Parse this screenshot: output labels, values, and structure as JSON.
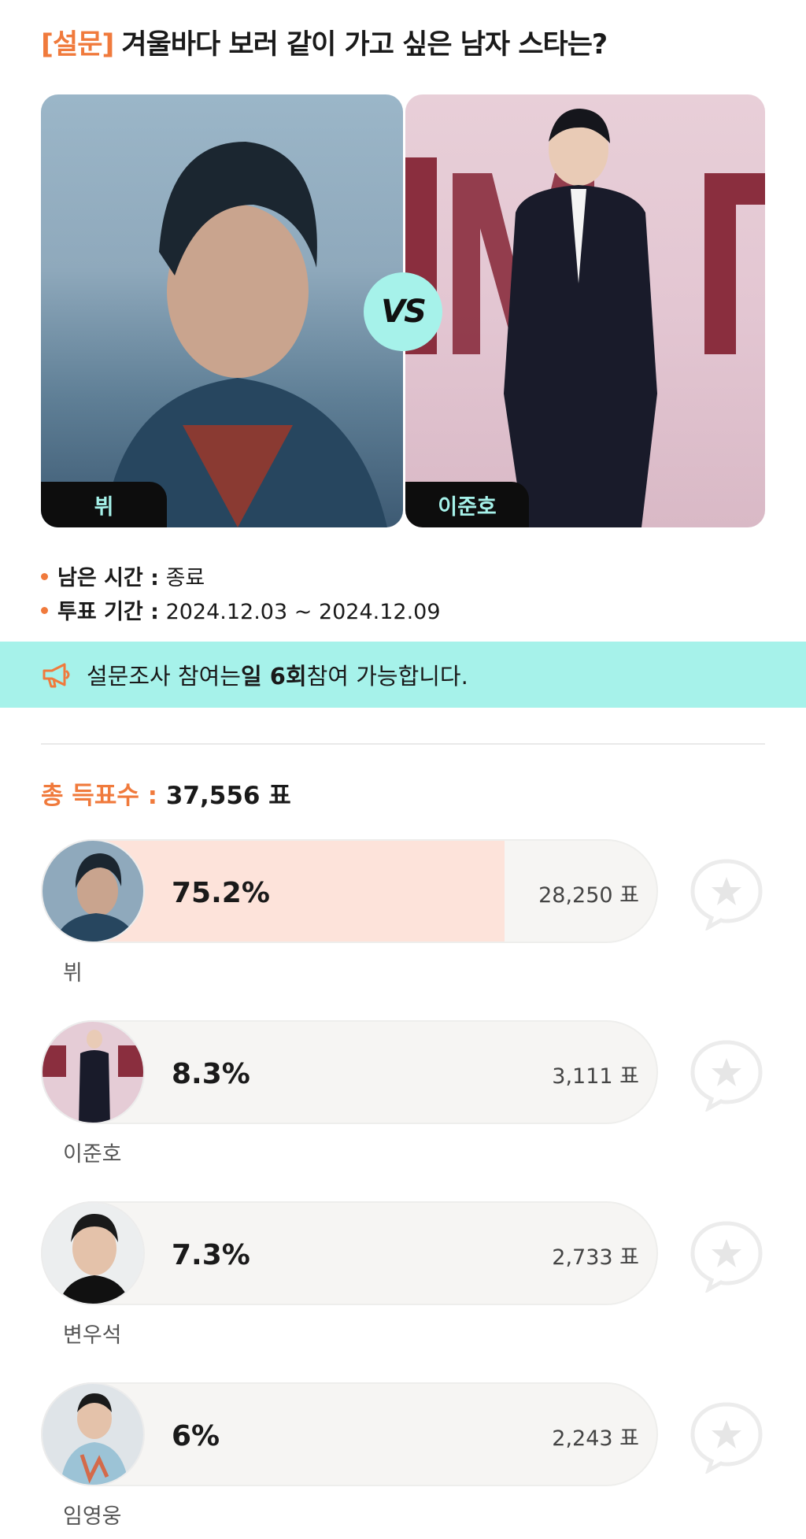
{
  "title": {
    "tag": "[설문]",
    "text": "겨울바다 보러 같이 가고 싶은 남자 스타는?"
  },
  "matchup": {
    "left_name": "뷔",
    "right_name": "이준호",
    "vs": "VS"
  },
  "info": {
    "remaining_key": "남은 시간 :",
    "remaining_value": "종료",
    "period_key": "투표 기간 :",
    "period_value": "2024.12.03 ~ 2024.12.09"
  },
  "banner": {
    "pre": "설문조사 참여는 ",
    "bold": "일 6회",
    "post": " 참여 가능합니다.",
    "icon": "megaphone-icon"
  },
  "total": {
    "label": "총 득표수 :",
    "value": "37,556 표"
  },
  "results": [
    {
      "name": "뷔",
      "percent": "75.2%",
      "votes": "28,250 표",
      "fill": 0.752
    },
    {
      "name": "이준호",
      "percent": "8.3%",
      "votes": "3,111 표",
      "fill": 0.083
    },
    {
      "name": "변우석",
      "percent": "7.3%",
      "votes": "2,733 표",
      "fill": 0.073
    },
    {
      "name": "임영웅",
      "percent": "6%",
      "votes": "2,243 표",
      "fill": 0.06
    }
  ],
  "colors": {
    "accent": "#f07a3c",
    "mint": "#a6f2ea",
    "bar_fill": "#fde3da"
  }
}
